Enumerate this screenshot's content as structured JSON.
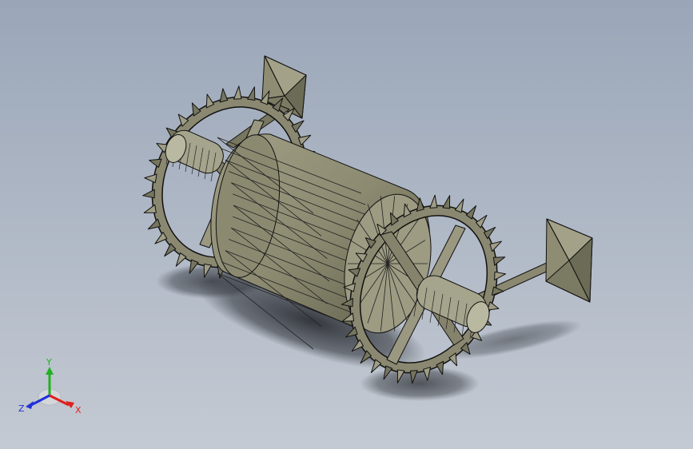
{
  "viewport": {
    "background_top": "#9aa6b8",
    "background_bottom": "#c4cad3",
    "model_color": "#8c8b72",
    "edge_color": "#111111"
  },
  "triad": {
    "x_label": "X",
    "y_label": "Y",
    "z_label": "Z",
    "x_color": "#e0201c",
    "y_color": "#22b022",
    "z_color": "#2030d8"
  }
}
